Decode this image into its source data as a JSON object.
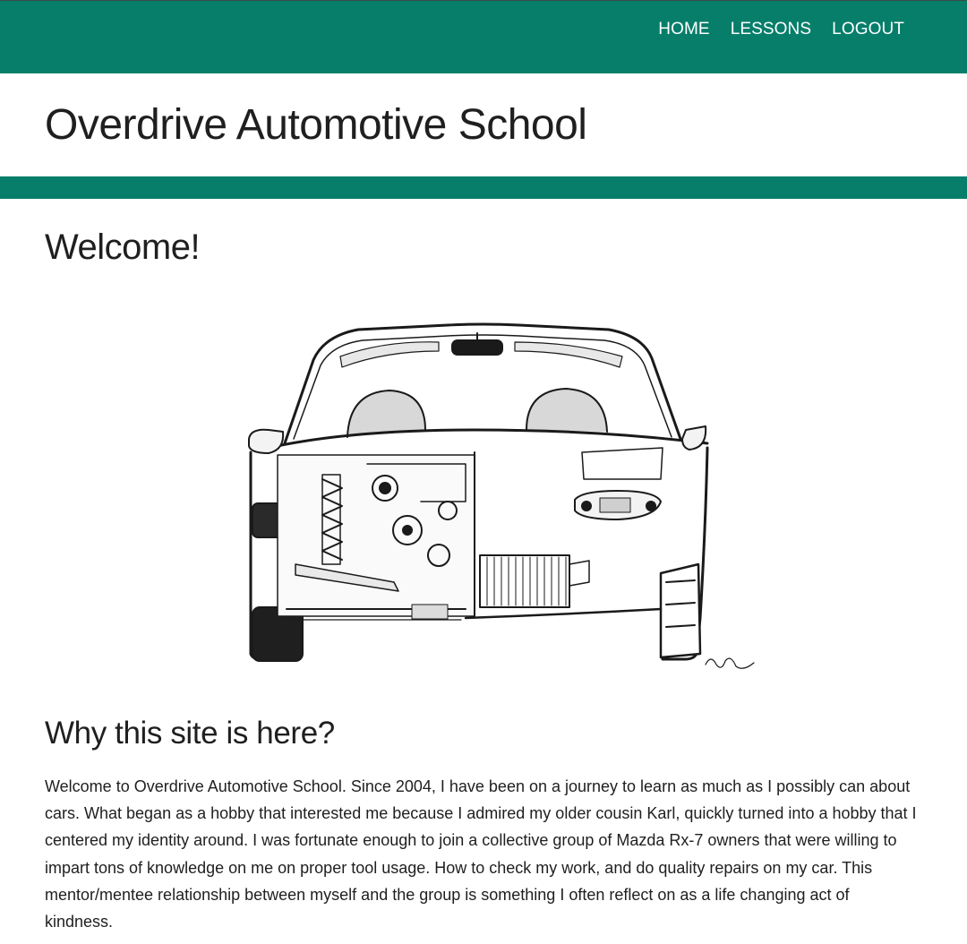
{
  "nav": {
    "items": [
      {
        "label": "HOME"
      },
      {
        "label": "LESSONS"
      },
      {
        "label": "LOGOUT"
      }
    ]
  },
  "header": {
    "title": "Overdrive Automotive School"
  },
  "main": {
    "welcome_heading": "Welcome!",
    "hero_image": {
      "icon": "car-cutaway-illustration"
    },
    "section_heading": "Why this site is here?",
    "intro_paragraph": "Welcome to Overdrive Automotive School. Since 2004, I have been on a journey to learn as much as I possibly can about cars. What began as a hobby that interested me because I admired my older cousin Karl, quickly turned into a hobby that I centered my identity around. I was fortunate enough to join a collective group of Mazda Rx-7 owners that were willing to impart tons of knowledge on me on proper tool usage. How to check my work, and do quality repairs on my car. This mentor/mentee relationship between myself and the group is something I often reflect on as a life changing act of kindness."
  },
  "colors": {
    "brand": "#067e6a",
    "text": "#1f1f1f",
    "background": "#ffffff"
  }
}
